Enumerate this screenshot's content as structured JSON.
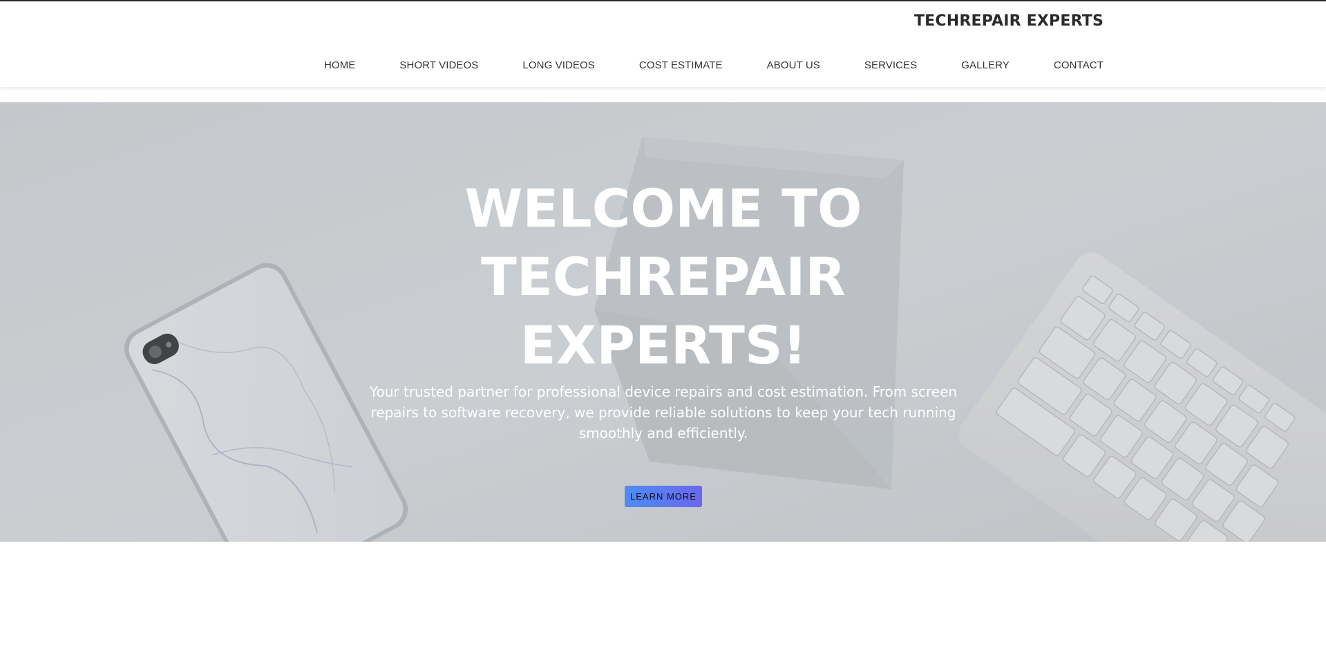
{
  "header": {
    "brand": "TECHREPAIR EXPERTS",
    "nav": [
      {
        "label": "HOME"
      },
      {
        "label": "SHORT VIDEOS"
      },
      {
        "label": "LONG VIDEOS"
      },
      {
        "label": "COST ESTIMATE"
      },
      {
        "label": "ABOUT US"
      },
      {
        "label": "SERVICES"
      },
      {
        "label": "GALLERY"
      },
      {
        "label": "CONTACT"
      }
    ]
  },
  "hero": {
    "title_lines": [
      "WELCOME TO",
      "TECHREPAIR",
      "EXPERTS!"
    ],
    "subtitle": "Your trusted partner for professional device repairs and cost estimation. From screen repairs to software recovery, we provide reliable solutions to keep your tech running smoothly and efficiently.",
    "cta_label": "LEARN MORE",
    "cta_color_start": "#4d8cf5",
    "cta_color_end": "#6a67f0",
    "background_icons": [
      "smartphone-icon",
      "envelope-icon",
      "keyboard-icon"
    ]
  }
}
